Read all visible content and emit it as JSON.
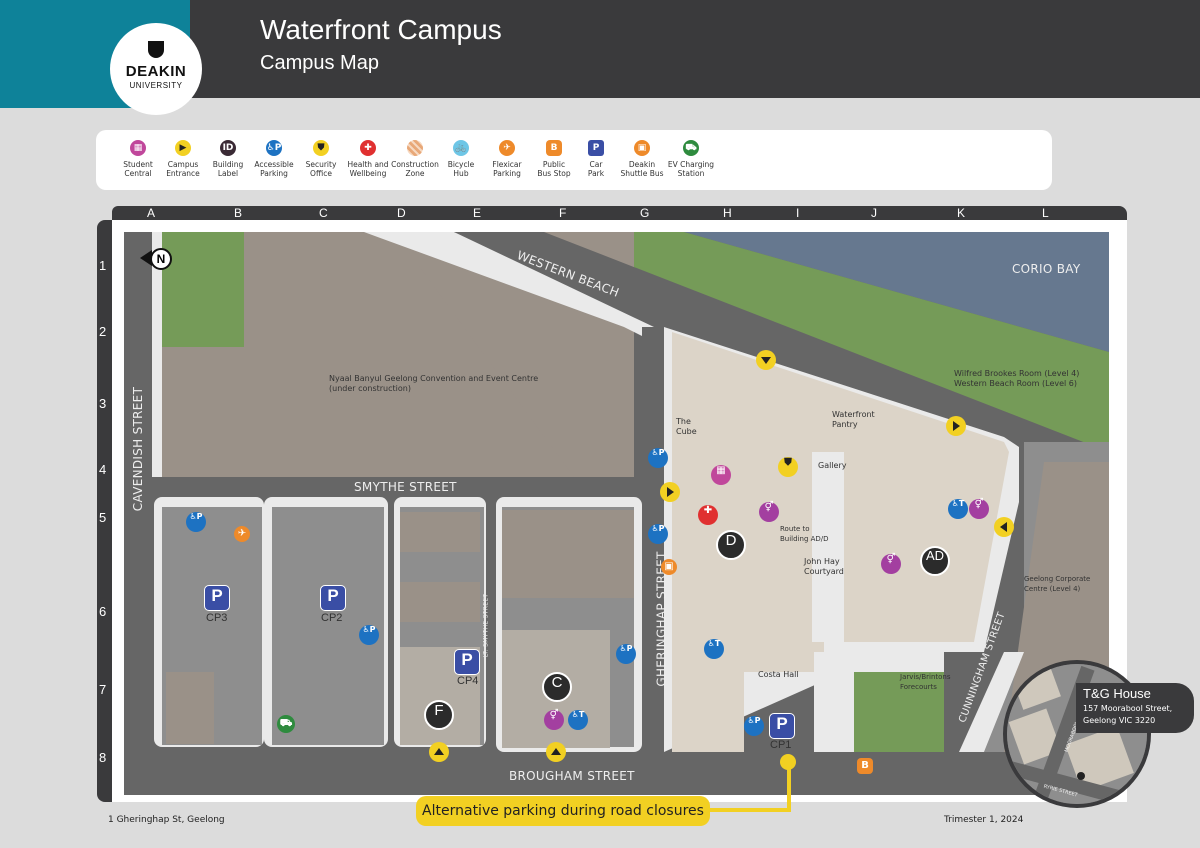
{
  "header": {
    "logo_line1": "DEAKIN",
    "logo_line2": "UNIVERSITY",
    "title": "Waterfront Campus",
    "subtitle": "Campus Map"
  },
  "legend": [
    {
      "icon": "student-central-icon",
      "glyph": "▦",
      "color": "#c0479b",
      "label1": "Student",
      "label2": "Central"
    },
    {
      "icon": "campus-entrance-icon",
      "glyph": "▶",
      "color": "#f2d022",
      "label1": "Campus",
      "label2": "Entrance"
    },
    {
      "icon": "building-label-icon",
      "glyph": "ID",
      "color": "#3a2a35",
      "label1": "Building",
      "label2": "Label"
    },
    {
      "icon": "accessible-parking-icon",
      "glyph": "♿P",
      "color": "#1d72c2",
      "label1": "Accessible",
      "label2": "Parking"
    },
    {
      "icon": "security-office-icon",
      "glyph": "⛊",
      "color": "#f2d022",
      "label1": "Security",
      "label2": "Office"
    },
    {
      "icon": "health-wellbeing-icon",
      "glyph": "✚",
      "color": "#e03030",
      "label1": "Health and",
      "label2": "Wellbeing"
    },
    {
      "icon": "construction-zone-icon",
      "glyph": "",
      "color": "#e8a878",
      "label1": "Construction",
      "label2": "Zone"
    },
    {
      "icon": "bicycle-hub-icon",
      "glyph": "🚲",
      "color": "#6ec6e6",
      "label1": "Bicycle",
      "label2": "Hub"
    },
    {
      "icon": "flexicar-parking-icon",
      "glyph": "✈",
      "color": "#ee8a2a",
      "label1": "Flexicar",
      "label2": "Parking"
    },
    {
      "icon": "public-bus-stop-icon",
      "glyph": "B",
      "color": "#ee8a2a",
      "label1": "Public",
      "label2": "Bus Stop"
    },
    {
      "icon": "car-park-icon",
      "glyph": "P",
      "color": "#3a4ea5",
      "label1": "Car",
      "label2": "Park"
    },
    {
      "icon": "deakin-shuttle-bus-icon",
      "glyph": "▣",
      "color": "#ee8a2a",
      "label1": "Deakin",
      "label2": "Shuttle Bus"
    },
    {
      "icon": "ev-charging-station-icon",
      "glyph": "⛟",
      "color": "#2e8b3e",
      "label1": "EV Charging",
      "label2": "Station"
    }
  ],
  "grid": {
    "columns": [
      "A",
      "B",
      "C",
      "D",
      "E",
      "F",
      "G",
      "H",
      "I",
      "J",
      "K",
      "L"
    ],
    "rows": [
      "1",
      "2",
      "3",
      "4",
      "5",
      "6",
      "7",
      "8"
    ]
  },
  "map": {
    "north": "N",
    "streets": {
      "western_beach": "WESTERN BEACH",
      "corio_bay": "CORIO BAY",
      "cavendish": "CAVENDISH STREET",
      "smythe": "SMYTHE STREET",
      "lt_smythe": "LT. SMYTHE STREET",
      "gheringhap": "GHERINGHAP STREET",
      "brougham": "BROUGHAM STREET",
      "cunningham": "CUNNINGHAM STREET"
    },
    "labels": {
      "convention_1": "Nyaal Banyul Geelong Convention and Event Centre",
      "convention_2": "(under construction)",
      "the_cube_1": "The",
      "the_cube_2": "Cube",
      "waterfront_pantry_1": "Waterfront",
      "waterfront_pantry_2": "Pantry",
      "gallery": "Gallery",
      "wilfred_1": "Wilfred Brookes Room (Level 4)",
      "wilfred_2": "Western Beach Room (Level 6)",
      "route_1": "Route to",
      "route_2": "Building AD/D",
      "john_hay_1": "John Hay",
      "john_hay_2": "Courtyard",
      "geelong_corp_1": "Geelong Corporate",
      "geelong_corp_2": "Centre (Level 4)",
      "costa_hall": "Costa Hall",
      "jarvis_1": "Jarvis/Brintons",
      "jarvis_2": "Forecourts"
    },
    "buildings": [
      "D",
      "AD",
      "C",
      "F"
    ],
    "car_parks": [
      "CP1",
      "CP2",
      "CP3",
      "CP4"
    ],
    "parking_glyph": "P",
    "bus_glyph": "B"
  },
  "tg_house": {
    "name": "T&G House",
    "address1": "157 Moorabool Street,",
    "address2": "Geelong VIC 3220",
    "street1": "MOORABOOL STREET",
    "street2": "RYRIE STREET"
  },
  "footer": {
    "address": "1 Gheringhap St, Geelong",
    "alt_parking": "Alternative parking during road closures",
    "trimester": "Trimester 1, 2024"
  }
}
